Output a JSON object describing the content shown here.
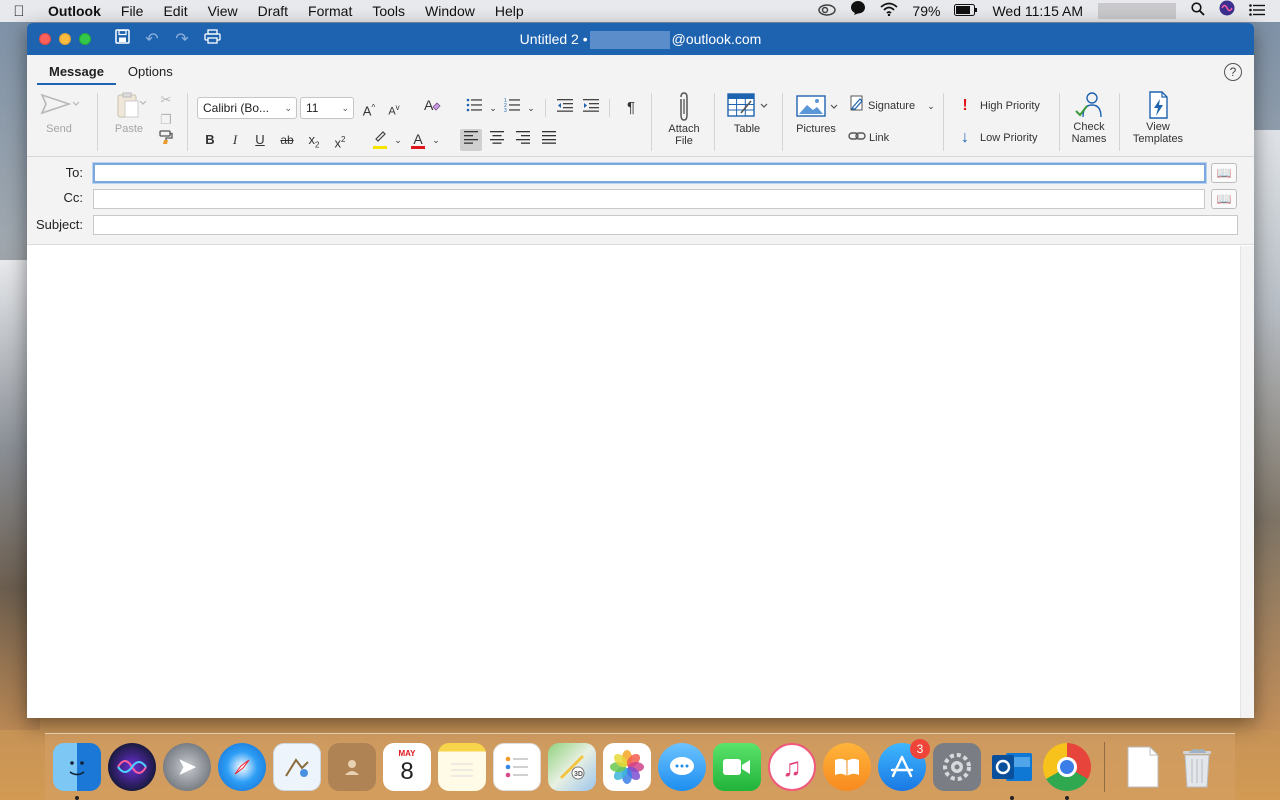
{
  "menubar": {
    "app": "Outlook",
    "items": [
      "File",
      "Edit",
      "View",
      "Draft",
      "Format",
      "Tools",
      "Window",
      "Help"
    ],
    "battery": "79%",
    "clock": "Wed 11:15 AM"
  },
  "window": {
    "title_prefix": "Untitled 2 •",
    "title_suffix": "@outlook.com"
  },
  "tabs": [
    "Message",
    "Options"
  ],
  "help_label": "?",
  "ribbon": {
    "send": "Send",
    "paste": "Paste",
    "font_name": "Calibri (Bo...",
    "font_size": "11",
    "bold": "B",
    "italic": "I",
    "underline": "U",
    "strike": "ab",
    "subscript": "x",
    "superscript": "x",
    "attach_file_l1": "Attach",
    "attach_file_l2": "File",
    "table": "Table",
    "pictures": "Pictures",
    "signature": "Signature",
    "link": "Link",
    "high_priority": "High Priority",
    "low_priority": "Low Priority",
    "check_names_l1": "Check",
    "check_names_l2": "Names",
    "view_templates_l1": "View",
    "view_templates_l2": "Templates",
    "highlight_color": "#f5e400",
    "font_color": "#e0161d"
  },
  "fields": {
    "to_label": "To:",
    "cc_label": "Cc:",
    "subject_label": "Subject:",
    "to_value": "",
    "cc_value": "",
    "subject_value": ""
  },
  "dock": {
    "calendar_month": "MAY",
    "calendar_day": "8",
    "appstore_badge": "3"
  },
  "colors": {
    "accent": "#1e63b0"
  }
}
